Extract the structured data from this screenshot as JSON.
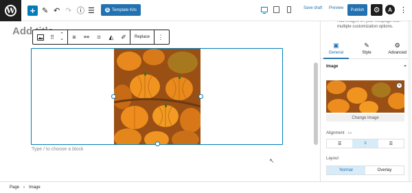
{
  "toolbar": {
    "logo_glyph": "W",
    "add_icon": "plus-icon",
    "template_kits_label": "Template Kits",
    "save_draft_label": "Save draft",
    "preview_label": "Preview",
    "publish_label": "Publish"
  },
  "editor": {
    "title_placeholder": "Add title",
    "appender_text": "Type / to choose a block",
    "block_toolbar": {
      "replace_label": "Replace"
    }
  },
  "sidebar": {
    "description": "Add images on your webpage with multiple customization options.",
    "tabs": [
      {
        "label": "General",
        "icon": "general-icon",
        "active": true
      },
      {
        "label": "Style",
        "icon": "style-icon",
        "active": false
      },
      {
        "label": "Advanced",
        "icon": "gear-icon",
        "active": false
      }
    ],
    "section_title": "Image",
    "change_image_label": "Change Image",
    "alignment_label": "Alignment",
    "layout_label": "Layout",
    "layout_options": [
      "Normal",
      "Overlay"
    ]
  },
  "breadcrumb": {
    "items": [
      "Page",
      "Image"
    ]
  },
  "colors": {
    "accent": "#2271b1",
    "selection": "#007cba",
    "dark": "#1e1e1e"
  }
}
